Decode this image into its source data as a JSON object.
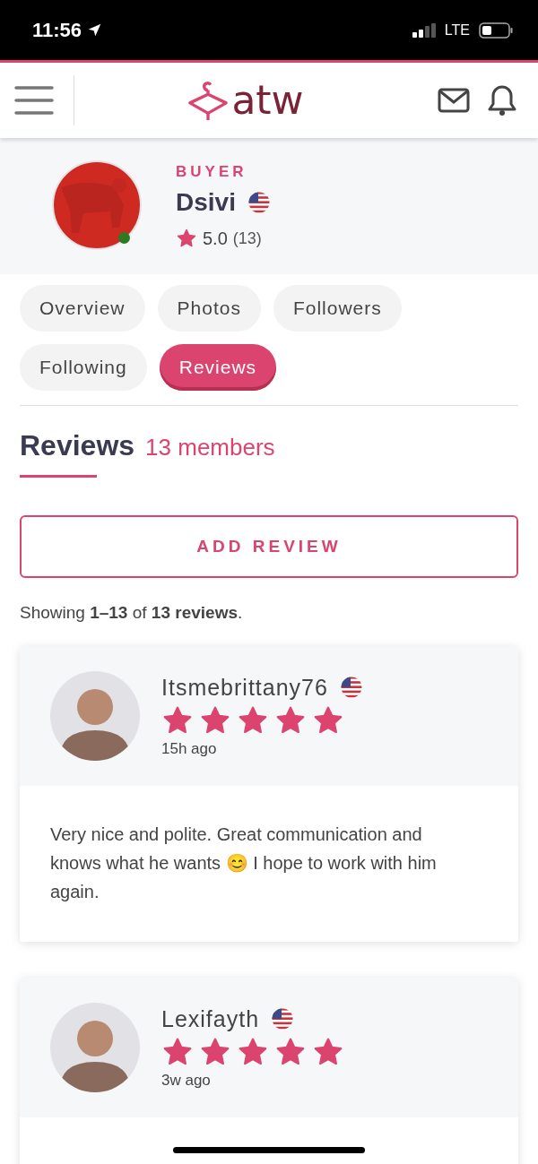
{
  "status_bar": {
    "time": "11:56",
    "network": "LTE"
  },
  "header": {
    "logo": "atw"
  },
  "profile": {
    "role": "BUYER",
    "name": "Dsivi",
    "online": true,
    "rating": "5.0",
    "rating_count": "(13)"
  },
  "tabs": [
    {
      "label": "Overview",
      "selected": false
    },
    {
      "label": "Photos",
      "selected": false
    },
    {
      "label": "Followers",
      "selected": false
    },
    {
      "label": "Following",
      "selected": false
    },
    {
      "label": "Reviews",
      "selected": true
    }
  ],
  "section": {
    "title": "Reviews",
    "count": "13 members"
  },
  "add_review_button": "ADD REVIEW",
  "summary": "Showing **1–13** of **13 reviews**.",
  "reviews": [
    {
      "author": "Itsmebrittany76",
      "stars": 5,
      "time": "15h ago",
      "text": "Very nice and polite. Great communication and knows what he wants 😊 I hope to work with him again."
    },
    {
      "author": "Lexifayth",
      "stars": 5,
      "time": "3w ago"
    }
  ]
}
